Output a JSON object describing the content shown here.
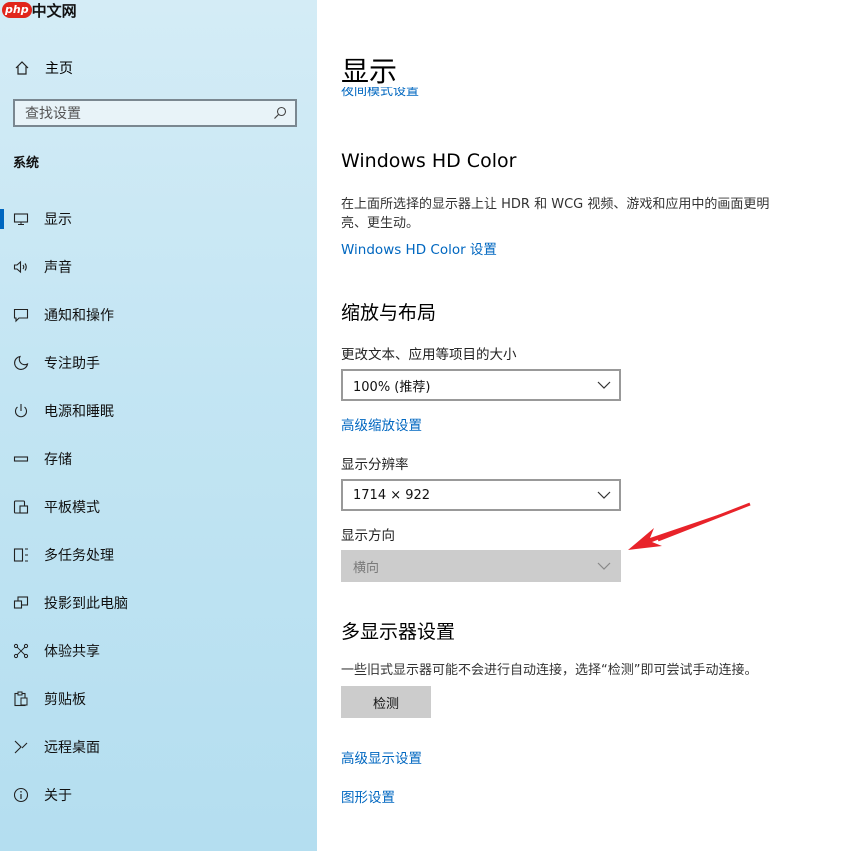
{
  "watermark": {
    "logo": "php",
    "text": "中文网"
  },
  "sidebar": {
    "home_label": "主页",
    "search_placeholder": "查找设置",
    "section_label": "系统",
    "items": [
      {
        "label": "显示",
        "icon": "monitor-icon"
      },
      {
        "label": "声音",
        "icon": "speaker-icon"
      },
      {
        "label": "通知和操作",
        "icon": "message-icon"
      },
      {
        "label": "专注助手",
        "icon": "moon-icon"
      },
      {
        "label": "电源和睡眠",
        "icon": "power-icon"
      },
      {
        "label": "存储",
        "icon": "drive-icon"
      },
      {
        "label": "平板模式",
        "icon": "tablet-icon"
      },
      {
        "label": "多任务处理",
        "icon": "multitask-icon"
      },
      {
        "label": "投影到此电脑",
        "icon": "project-icon"
      },
      {
        "label": "体验共享",
        "icon": "share-icon"
      },
      {
        "label": "剪贴板",
        "icon": "clipboard-icon"
      },
      {
        "label": "远程桌面",
        "icon": "remote-icon"
      },
      {
        "label": "关于",
        "icon": "info-icon"
      }
    ],
    "selected_index": 0
  },
  "main": {
    "title": "显示",
    "night_light_link": "夜间模式设置",
    "hdr": {
      "heading": "Windows HD Color",
      "description": "在上面所选择的显示器上让 HDR 和 WCG 视频、游戏和应用中的画面更明亮、更生动。",
      "link": "Windows HD Color 设置"
    },
    "scale": {
      "heading": "缩放与布局",
      "size_label": "更改文本、应用等项目的大小",
      "size_value": "100% (推荐)",
      "advanced_link": "高级缩放设置",
      "resolution_label": "显示分辨率",
      "resolution_value": "1714 × 922",
      "orientation_label": "显示方向",
      "orientation_value": "横向"
    },
    "multi": {
      "heading": "多显示器设置",
      "description": "一些旧式显示器可能不会进行自动连接，选择“检测”即可尝试手动连接。",
      "detect_button": "检测"
    },
    "advanced_display_link": "高级显示设置",
    "graphics_link": "图形设置"
  },
  "colors": {
    "accent": "#0067c0",
    "annotation_arrow": "#e8232a"
  }
}
